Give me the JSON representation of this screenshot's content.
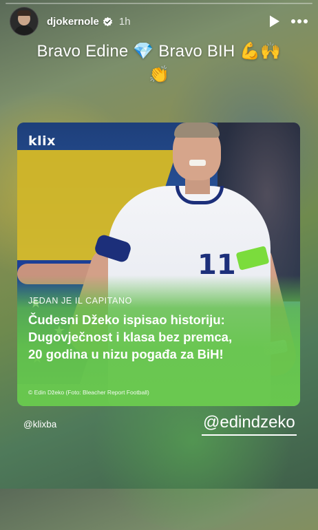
{
  "story": {
    "progress": 0.0,
    "username": "djokernole",
    "time": "1h",
    "caption_line1": "Bravo Edine 💎 Bravo BIH 💪🙌",
    "caption_line2": "👏"
  },
  "card": {
    "brand": "klix",
    "jersey_number": "11",
    "kicker": "JEDAN JE IL CAPITANO",
    "headline": "Čudesni Džeko ispisao historiju: Dugovječnost i klasa bez premca, 20 godina u nizu pogađa za BiH!",
    "credit": "© Edin Džeko (Foto: Bleacher Report Football)"
  },
  "mentions": {
    "left": "@klixba",
    "right": "@edindzeko"
  },
  "colors": {
    "overlay_green": "#64c44a",
    "jersey_navy": "#1c2f7a",
    "verified_blue": "#3897f0"
  },
  "icons": {
    "verified": "verified-badge-icon",
    "play": "play-icon",
    "more": "more-horizontal-icon"
  }
}
